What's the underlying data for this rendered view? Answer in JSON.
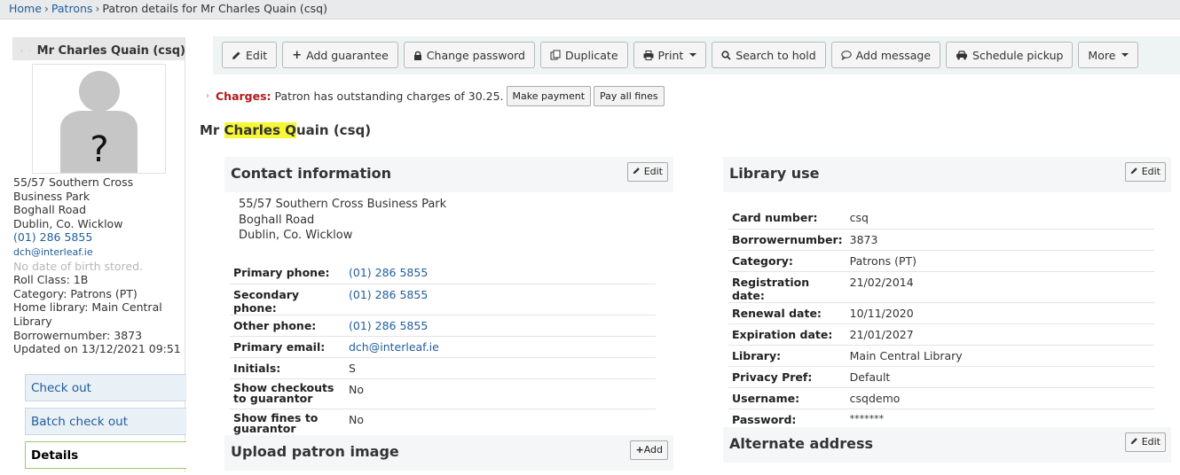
{
  "breadcrumb": {
    "home": "Home",
    "patrons": "Patrons",
    "current": "Patron details for Mr Charles Quain (csq)",
    "separator": "›"
  },
  "sidebar": {
    "patron_name": "Mr Charles Quain (csq)",
    "photo_placeholder": "?",
    "address_line1": "55/57 Southern Cross Business Park",
    "address_line2": "Boghall Road",
    "address_line3": "Dublin, Co. Wicklow",
    "phone": "(01) 286 5855",
    "email": "dch@interleaf.ie",
    "dob_note": "No date of birth stored.",
    "roll_class": "Roll Class: 1B",
    "category": "Category: Patrons (PT)",
    "home_library": "Home library: Main Central Library",
    "borrowernumber": "Borrowernumber: 3873",
    "updated": "Updated on 13/12/2021 09:51",
    "nav": [
      {
        "label": "Check out"
      },
      {
        "label": "Batch check out"
      },
      {
        "label": "Details"
      }
    ]
  },
  "toolbar": {
    "edit": "Edit",
    "add_guarantee": "Add guarantee",
    "change_password": "Change password",
    "duplicate": "Duplicate",
    "print": "Print",
    "search_to_hold": "Search to hold",
    "add_message": "Add message",
    "schedule_pickup": "Schedule pickup",
    "more": "More"
  },
  "charges": {
    "label": "Charges:",
    "text": "Patron has outstanding charges of 30.25.",
    "make_payment": "Make payment",
    "pay_all_fines": "Pay all fines"
  },
  "title": {
    "prefix": "Mr ",
    "highlight": "Charles Q",
    "suffix": "uain (csq)"
  },
  "contact": {
    "heading": "Contact information",
    "edit": "Edit",
    "address": [
      "55/57 Southern Cross Business Park",
      "Boghall Road",
      "Dublin, Co. Wicklow"
    ],
    "rows": [
      {
        "label": "Primary phone:",
        "value": "(01) 286 5855",
        "link": true
      },
      {
        "label": "Secondary phone:",
        "value": "(01) 286 5855",
        "link": true
      },
      {
        "label": "Other phone:",
        "value": "(01) 286 5855",
        "link": true
      },
      {
        "label": "Primary email:",
        "value": "dch@interleaf.ie",
        "link": true
      },
      {
        "label": "Initials:",
        "value": "S",
        "link": false
      },
      {
        "label": "Show checkouts to guarantor",
        "value": "No",
        "link": false
      },
      {
        "label": "Show fines to guarantor",
        "value": "No",
        "link": false
      }
    ]
  },
  "upload": {
    "heading": "Upload patron image",
    "add": "Add"
  },
  "library_use": {
    "heading": "Library use",
    "edit": "Edit",
    "rows": [
      {
        "label": "Card number:",
        "value": "csq"
      },
      {
        "label": "Borrowernumber:",
        "value": "3873"
      },
      {
        "label": "Category:",
        "value": "Patrons (PT)"
      },
      {
        "label": "Registration date:",
        "value": "21/02/2014"
      },
      {
        "label": "Renewal date:",
        "value": "10/11/2020"
      },
      {
        "label": "Expiration date:",
        "value": "21/01/2027"
      },
      {
        "label": "Library:",
        "value": "Main Central Library"
      },
      {
        "label": "Privacy Pref:",
        "value": "Default"
      },
      {
        "label": "Username:",
        "value": "csqdemo"
      },
      {
        "label": "Password:",
        "value": "*******"
      }
    ]
  },
  "alternate": {
    "heading": "Alternate address",
    "edit": "Edit"
  }
}
